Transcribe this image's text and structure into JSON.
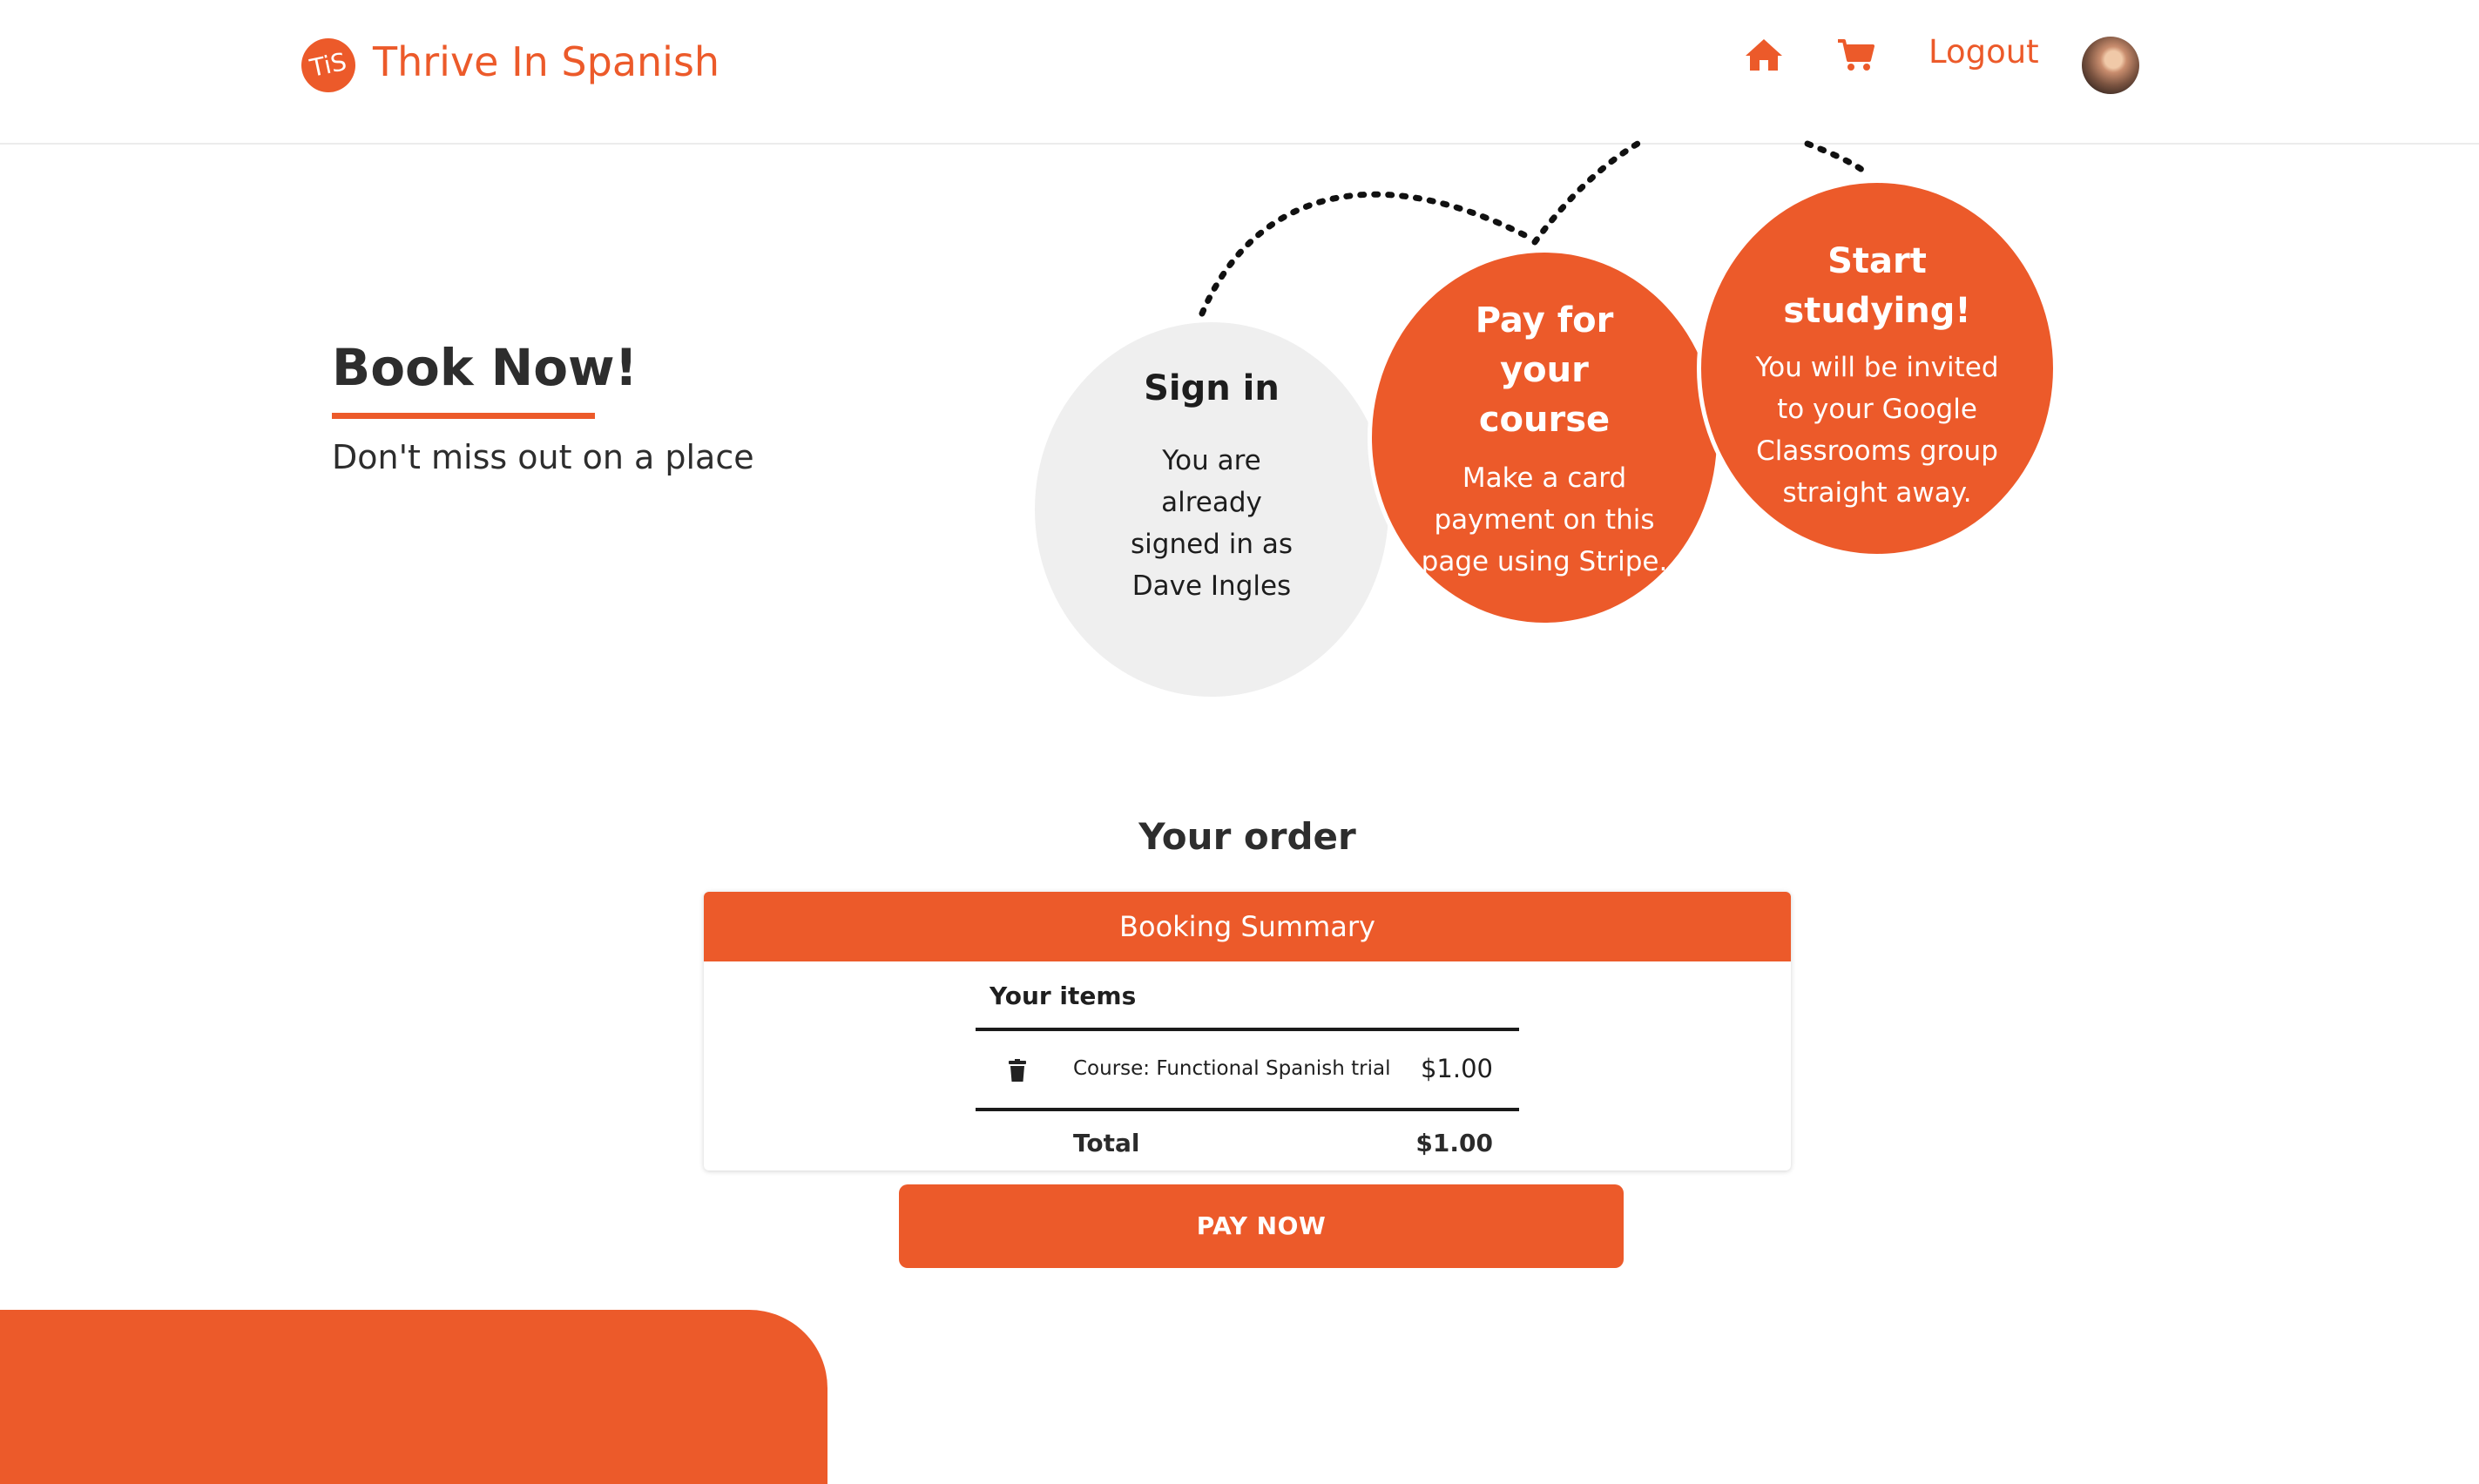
{
  "header": {
    "logo_text": "TiS",
    "site_title": "Thrive In Spanish",
    "nav": {
      "home_icon": "home-icon",
      "cart_icon": "cart-icon",
      "logout_label": "Logout"
    }
  },
  "hero": {
    "title": "Book Now!",
    "subtitle": "Don't miss out on a place"
  },
  "steps": [
    {
      "title": "Sign in",
      "text": "You are already signed in as Dave Ingles"
    },
    {
      "title": "Pay for your course",
      "text": "Make a card payment on this page using Stripe."
    },
    {
      "title": "Start studying!",
      "text": "You will be invited to your Google Classrooms group straight away."
    }
  ],
  "order": {
    "heading": "Your order",
    "summary_title": "Booking Summary",
    "items_label": "Your items",
    "items": [
      {
        "name": "Course: Functional Spanish trial",
        "price": "$1.00",
        "remove_icon": "trash-icon"
      }
    ],
    "total_label": "Total",
    "total_value": "$1.00",
    "pay_button": "PAY NOW"
  },
  "colors": {
    "accent": "#ec5a2a",
    "step_inactive": "#efefef",
    "text_dark": "#2d2d2d"
  }
}
